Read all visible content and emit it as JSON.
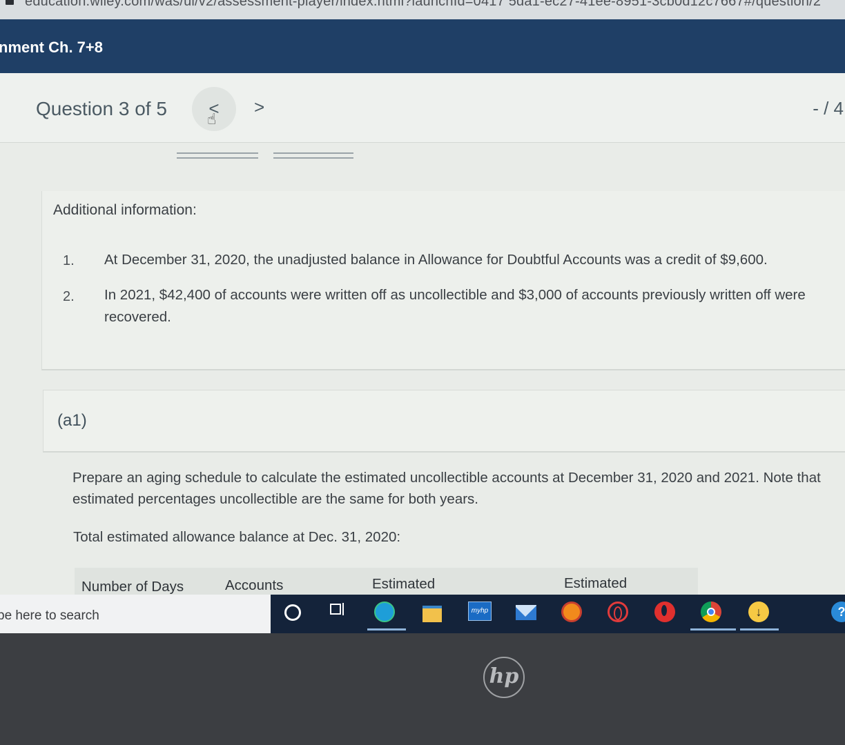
{
  "browser": {
    "url": "education.wiley.com/was/ui/v2/assessment-player/index.html?launchId=0417 5da1-ec27-41ee-8951-3cb0d12c7667#/question/2"
  },
  "assignment": {
    "title": "nment Ch. 7+8"
  },
  "question_header": {
    "label": "Question 3 of 5",
    "prev": "<",
    "next": ">",
    "score": "- / 4"
  },
  "additional_info": {
    "heading": "Additional information:",
    "items": [
      {
        "num": "1.",
        "text": "At December 31, 2020, the unadjusted balance in Allowance for Doubtful Accounts was a credit of $9,600."
      },
      {
        "num": "2.",
        "line1": "In 2021, $42,400 of accounts were written off as uncollectible and $3,000 of accounts previously written off were",
        "line2": "recovered."
      }
    ]
  },
  "part": {
    "label": "(a1)",
    "prompt_line1": "Prepare an aging schedule to calculate the estimated uncollectible accounts at December 31, 2020 and 2021. Note that",
    "prompt_line2": "estimated percentages uncollectible are the same for both years.",
    "total_label": "Total estimated allowance balance at Dec. 31, 2020:"
  },
  "table": {
    "headers": [
      "Number of Days",
      "Accounts",
      "Estimated",
      "Estimated"
    ]
  },
  "taskbar": {
    "search_placeholder": "pe here to search",
    "icons": [
      "cortana-icon",
      "task-view-icon",
      "edge-icon",
      "file-explorer-icon",
      "myhp-icon",
      "mail-icon",
      "firefox-icon",
      "opera-outline-icon",
      "opera-icon",
      "chrome-icon",
      "download-icon",
      "help-icon"
    ],
    "myhp_label": "myhp"
  },
  "laptop": {
    "brand": "hp"
  }
}
